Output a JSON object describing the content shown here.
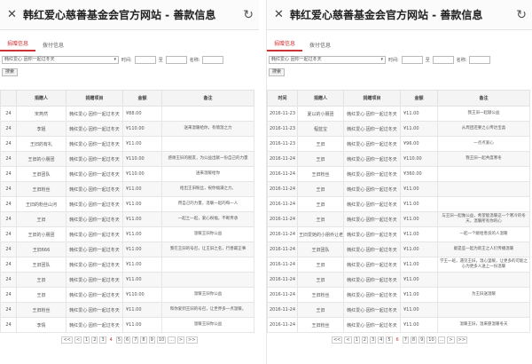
{
  "title": "韩红爱心慈善基金会官方网站 - 善款信息",
  "close_glyph": "✕",
  "refresh_glyph": "↻",
  "left": {
    "tabs": [
      "捐赠信息",
      "拨付信息"
    ],
    "filters": {
      "project": "韩红爱心 因你一起过冬天",
      "time_label": "时间:",
      "to_label": "至",
      "name_label": "名称:",
      "search": "搜索"
    },
    "headers": [
      "",
      "捐赠人",
      "捐赠项目",
      "金额",
      "备注"
    ],
    "rows": [
      [
        "24",
        "宋燕然",
        "韩红爱心·因你一起过冬天",
        "¥88.00",
        ""
      ],
      [
        "24",
        "李姐",
        "韩红爱心·因你一起过冬天",
        "¥110.00",
        "送来温暖给你，有情温之力"
      ],
      [
        "24",
        "王旧的有礼",
        "韩红爱心·因你一起过冬天",
        "¥11.00",
        ""
      ],
      [
        "24",
        "王旧的小朋团",
        "韩红爱心·因你一起过冬天",
        "¥110.00",
        "感谢王旧的朋友，为公益出献一份自己的力量"
      ],
      [
        "24",
        "王旧团队",
        "韩红爱心·因你一起过冬天",
        "¥110.00",
        "送来温暖给你"
      ],
      [
        "24",
        "王旧粉丝",
        "韩红爱心·因你一起过冬天",
        "¥11.00",
        "给出王旧粉丝，祝你福满之力。"
      ],
      [
        "24",
        "王旧的粉丝山河",
        "韩红爱心·因你一起过冬天",
        "¥11.00",
        "用自己的力量，温暖一起的每一人"
      ],
      [
        "24",
        "王旧",
        "韩红爱心·因你一起过冬天",
        "¥11.00",
        "一起土一起，爱心祝福，不断传承"
      ],
      [
        "24",
        "王旧的小朋团",
        "韩红爱心·因你一起过冬天",
        "¥11.00",
        "温暖王旧你公益"
      ],
      [
        "24",
        "王旧666",
        "韩红爱心·因你一起过冬天",
        "¥11.00",
        "我在王旧的号召，让王旧之名，行善最正事"
      ],
      [
        "24",
        "王旧团队",
        "韩红爱心·因你一起过冬天",
        "¥11.00",
        ""
      ],
      [
        "24",
        "王旧",
        "韩红爱心·因你一起过冬天",
        "¥11.00",
        ""
      ],
      [
        "24",
        "王旧",
        "韩红爱心·因你一起过冬天",
        "¥110.00",
        "温暖王旧你公益"
      ],
      [
        "24",
        "王旧粉丝",
        "韩红爱心·因你一起过冬天",
        "¥11.00",
        "和你爱到王旧的号召，让世界多一点温暖。"
      ],
      [
        "24",
        "李情",
        "韩红爱心·因你一起过冬天",
        "¥11.00",
        "温暖王旧你公益"
      ]
    ],
    "pager": [
      "<<",
      "<",
      "1",
      "2",
      "3",
      "4",
      "5",
      "6",
      "7",
      "8",
      "9",
      "10",
      "...",
      ">",
      ">>"
    ],
    "current_page": "4"
  },
  "right": {
    "tabs": [
      "捐赠信息",
      "拨付信息"
    ],
    "filters": {
      "project": "韩红爱心 因你一起过冬天",
      "time_label": "时间:",
      "to_label": "至",
      "name_label": "名称:",
      "search": "搜索"
    },
    "headers": [
      "时间",
      "捐赠人",
      "捐赠项目",
      "金额",
      "备注"
    ],
    "rows": [
      [
        "2016-11-23",
        "夏以的小朋团",
        "韩红爱心·因你一起过冬天",
        "¥11.00",
        "我王旧一起献公益"
      ],
      [
        "2016-11-23",
        "程蓝宝",
        "韩红爱心·因你一起过冬天",
        "¥11.00",
        "从周团还要之心传达宝晶"
      ],
      [
        "2016-11-23",
        "王旧",
        "韩红爱心·因你一起过冬天",
        "¥96.00",
        "一点点爱心"
      ],
      [
        "2016-11-24",
        "王旧",
        "韩红爱心·因你一起过冬天",
        "¥110.00",
        "我王旧一起共度寒冬"
      ],
      [
        "2016-11-24",
        "王旧粉丝",
        "韩红爱心·因你一起过冬天",
        "¥360.00",
        ""
      ],
      [
        "2016-11-24",
        "王旧",
        "韩红爱心·因你一起过冬天",
        "¥11.00",
        ""
      ],
      [
        "2016-11-24",
        "王旧",
        "韩红爱心·因你一起过冬天",
        "¥11.00",
        ""
      ],
      [
        "2016-11-24",
        "王旧",
        "韩红爱心·因你一起过冬天",
        "¥11.00",
        "与王旧一起做公益，希望能温暖这一个寒冷的冬天，温暖所有你的心"
      ],
      [
        "2016-11-24",
        "王旧爱她的小朋乔让老公",
        "韩红爱心·因你一起过冬天",
        "¥11.00",
        "一起一个献给善良的人温暖"
      ],
      [
        "2016-11-24",
        "王旧团队",
        "韩红爱心·因你一起过冬天",
        "¥11.00",
        "献是些一起为新王之人们传播温暖"
      ],
      [
        "2016-11-24",
        "王旧",
        "韩红爱心·因你一起过冬天",
        "¥11.00",
        "学王一班，遇见王旧，温心里暖，让更多的可能之心为更多人送上一份温暖"
      ],
      [
        "2016-11-24",
        "王旧",
        "韩红爱心·因你一起过冬天",
        "¥11.00",
        ""
      ],
      [
        "2016-11-24",
        "王旧粉丝",
        "韩红爱心·因你一起过冬天",
        "¥11.00",
        "为王旧送温暖"
      ],
      [
        "2016-11-24",
        "王旧",
        "韩红爱心·因你一起过冬天",
        "¥11.00",
        ""
      ],
      [
        "2016-11-24",
        "王旧粉丝",
        "韩红爱心·因你一起过冬天",
        "¥11.00",
        "温暖王旧，温来愿温暖冬天"
      ]
    ],
    "pager": [
      "<<",
      "<",
      "1",
      "2",
      "3",
      "4",
      "5",
      "6",
      "7",
      "8",
      "9",
      "10",
      "...",
      ">",
      ">>"
    ],
    "current_page": "6"
  }
}
